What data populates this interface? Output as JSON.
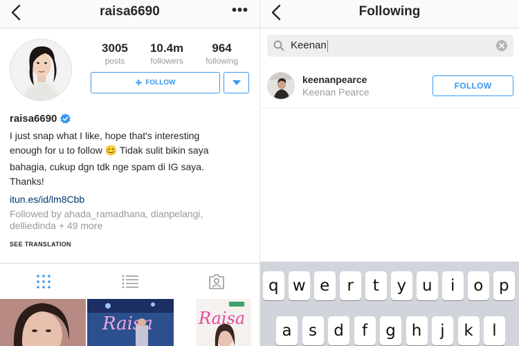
{
  "left": {
    "header": {
      "title": "raisa6690"
    },
    "stats": [
      {
        "num": "3005",
        "label": "posts"
      },
      {
        "num": "10.4m",
        "label": "followers"
      },
      {
        "num": "964",
        "label": "following"
      }
    ],
    "follow_label": "FOLLOW",
    "bio": {
      "username": "raisa6690",
      "line1": "I just snap what I like, hope that's interesting",
      "line2": "enough for u to follow",
      "emoji": "😊",
      "line2_rest": " Tidak sulit bikin saya",
      "line3": "bahagia, cukup dgn tdk nge spam di IG saya.",
      "line4": "Thanks!",
      "link": "itun.es/id/lm8Cbb",
      "followed_by": "Followed by ahada_ramadhana, dianpelangi, delliedinda + 49 more",
      "see_translation": "SEE TRANSLATION"
    },
    "grid_tabs": [
      "grid-icon",
      "list-icon",
      "tagged-icon"
    ]
  },
  "right": {
    "header": {
      "title": "Following"
    },
    "search": {
      "value": "Keenan"
    },
    "results": [
      {
        "username": "keenanpearce",
        "fullname": "Keenan Pearce",
        "button": "FOLLOW"
      }
    ],
    "keyboard": {
      "row1": [
        "q",
        "w",
        "e",
        "r",
        "t",
        "y",
        "u",
        "i",
        "o",
        "p"
      ],
      "row2": [
        "a",
        "s",
        "d",
        "f",
        "g",
        "h",
        "j",
        "k",
        "l"
      ]
    }
  },
  "colors": {
    "accent": "#3897f0",
    "link": "#003569",
    "muted": "#999999",
    "keyboard_bg": "#d1d5db"
  }
}
